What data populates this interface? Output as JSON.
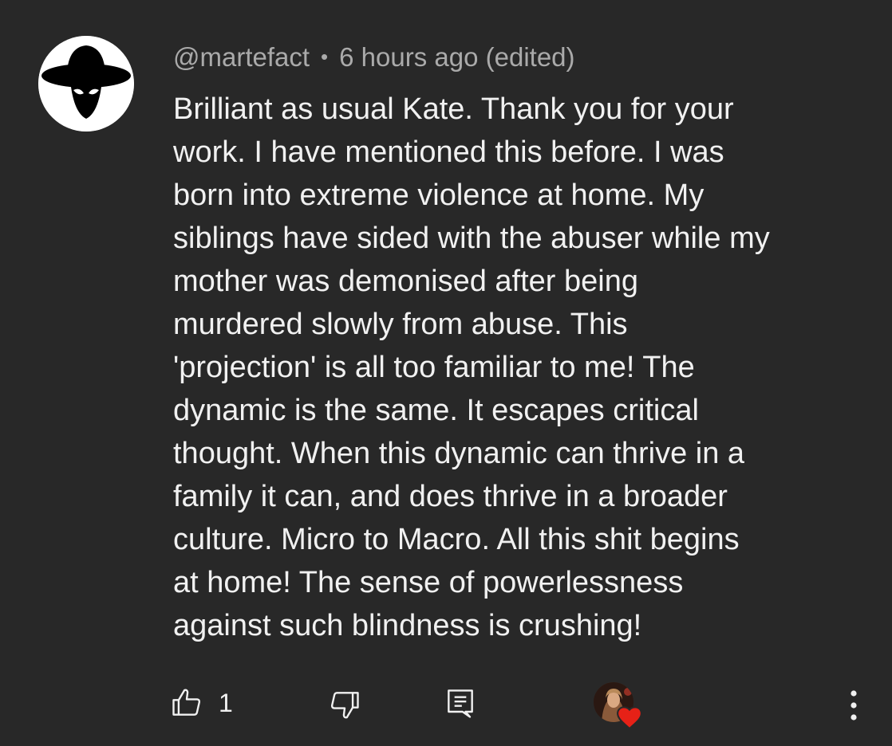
{
  "comment": {
    "author": "@martefact",
    "separator": "•",
    "timestamp": "6 hours ago (edited)",
    "text_lines": [
      "Brilliant as usual Kate. Thank you for your",
      "work. I have mentioned this before. I was",
      "born into extreme violence at home. My",
      "siblings have sided with the abuser while my",
      "mother was demonised after being",
      "murdered slowly from abuse. This",
      "'projection' is all too familiar to me! The",
      "dynamic is the same. It escapes critical",
      "thought. When this dynamic can thrive in a",
      "family it can, and does thrive in a broader",
      "culture. Micro to Macro. All this shit begins",
      "at home! The sense of powerlessness",
      "against such blindness is crushing!"
    ],
    "like_count": "1"
  },
  "icons": {
    "avatar": "hat-figure-avatar",
    "like": "thumbs-up-icon",
    "dislike": "thumbs-down-icon",
    "reply": "reply-icon",
    "creator_heart": "heart-icon",
    "more": "more-vertical-icon"
  },
  "colors": {
    "background": "#282828",
    "text_primary": "#f1f1f1",
    "text_secondary": "#aaaaaa",
    "heart": "#e62117"
  }
}
